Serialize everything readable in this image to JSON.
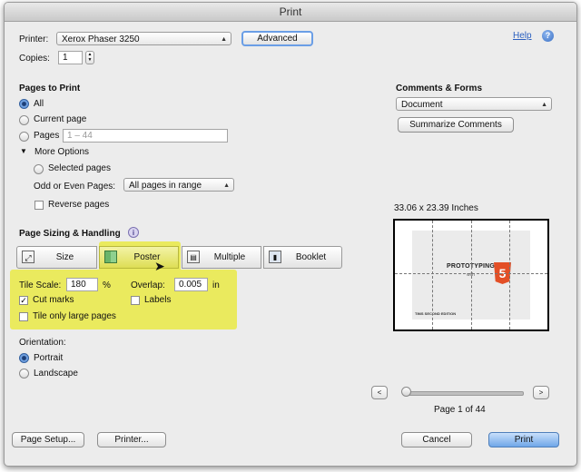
{
  "window": {
    "title": "Print"
  },
  "printer": {
    "label": "Printer:",
    "value": "Xerox Phaser 3250",
    "advanced_label": "Advanced",
    "help_label": "Help",
    "help_icon_glyph": "?"
  },
  "copies": {
    "label": "Copies:",
    "value": "1"
  },
  "pages_to_print": {
    "heading": "Pages to Print",
    "all_label": "All",
    "current_label": "Current page",
    "pages_label": "Pages",
    "pages_placeholder": "1 – 44",
    "more_options_label": "More Options",
    "selected_pages_label": "Selected pages",
    "odd_even_label": "Odd or Even Pages:",
    "odd_even_value": "All pages in range",
    "reverse_label": "Reverse pages",
    "selected": "All"
  },
  "comments": {
    "heading": "Comments & Forms",
    "value": "Document",
    "summarize_label": "Summarize Comments"
  },
  "sizing": {
    "heading": "Page Sizing & Handling",
    "info_glyph": "i",
    "modes": [
      {
        "label": "Size",
        "icon": "size-icon"
      },
      {
        "label": "Poster",
        "icon": "poster-icon",
        "selected": true
      },
      {
        "label": "Multiple",
        "icon": "multiple-icon"
      },
      {
        "label": "Booklet",
        "icon": "booklet-icon"
      }
    ],
    "tile_scale_label": "Tile Scale:",
    "tile_scale_value": "180",
    "tile_scale_unit": "%",
    "overlap_label": "Overlap:",
    "overlap_value": "0.005",
    "overlap_unit": "in",
    "cut_marks_label": "Cut marks",
    "cut_marks_checked": true,
    "labels_label": "Labels",
    "labels_checked": false,
    "tile_large_label": "Tile only large pages",
    "tile_large_checked": false
  },
  "orientation": {
    "label": "Orientation:",
    "portrait_label": "Portrait",
    "landscape_label": "Landscape",
    "selected": "Portrait"
  },
  "preview": {
    "size_label": "33.06 x 23.39 Inches",
    "page_label": "Page 1 of 44",
    "prev_glyph": "<",
    "next_glyph": ">",
    "image_title": "PROTOTYPING",
    "image_subtitle": "with",
    "image_badge": "5",
    "image_footer": "TIMS SECOND EDITION",
    "slider_position": 0
  },
  "footer": {
    "page_setup_label": "Page Setup...",
    "printer_label": "Printer...",
    "cancel_label": "Cancel",
    "print_label": "Print"
  },
  "colors": {
    "highlight": "#eaea5e",
    "default_button": "#6fa6e8",
    "html5_orange": "#e34f26"
  }
}
